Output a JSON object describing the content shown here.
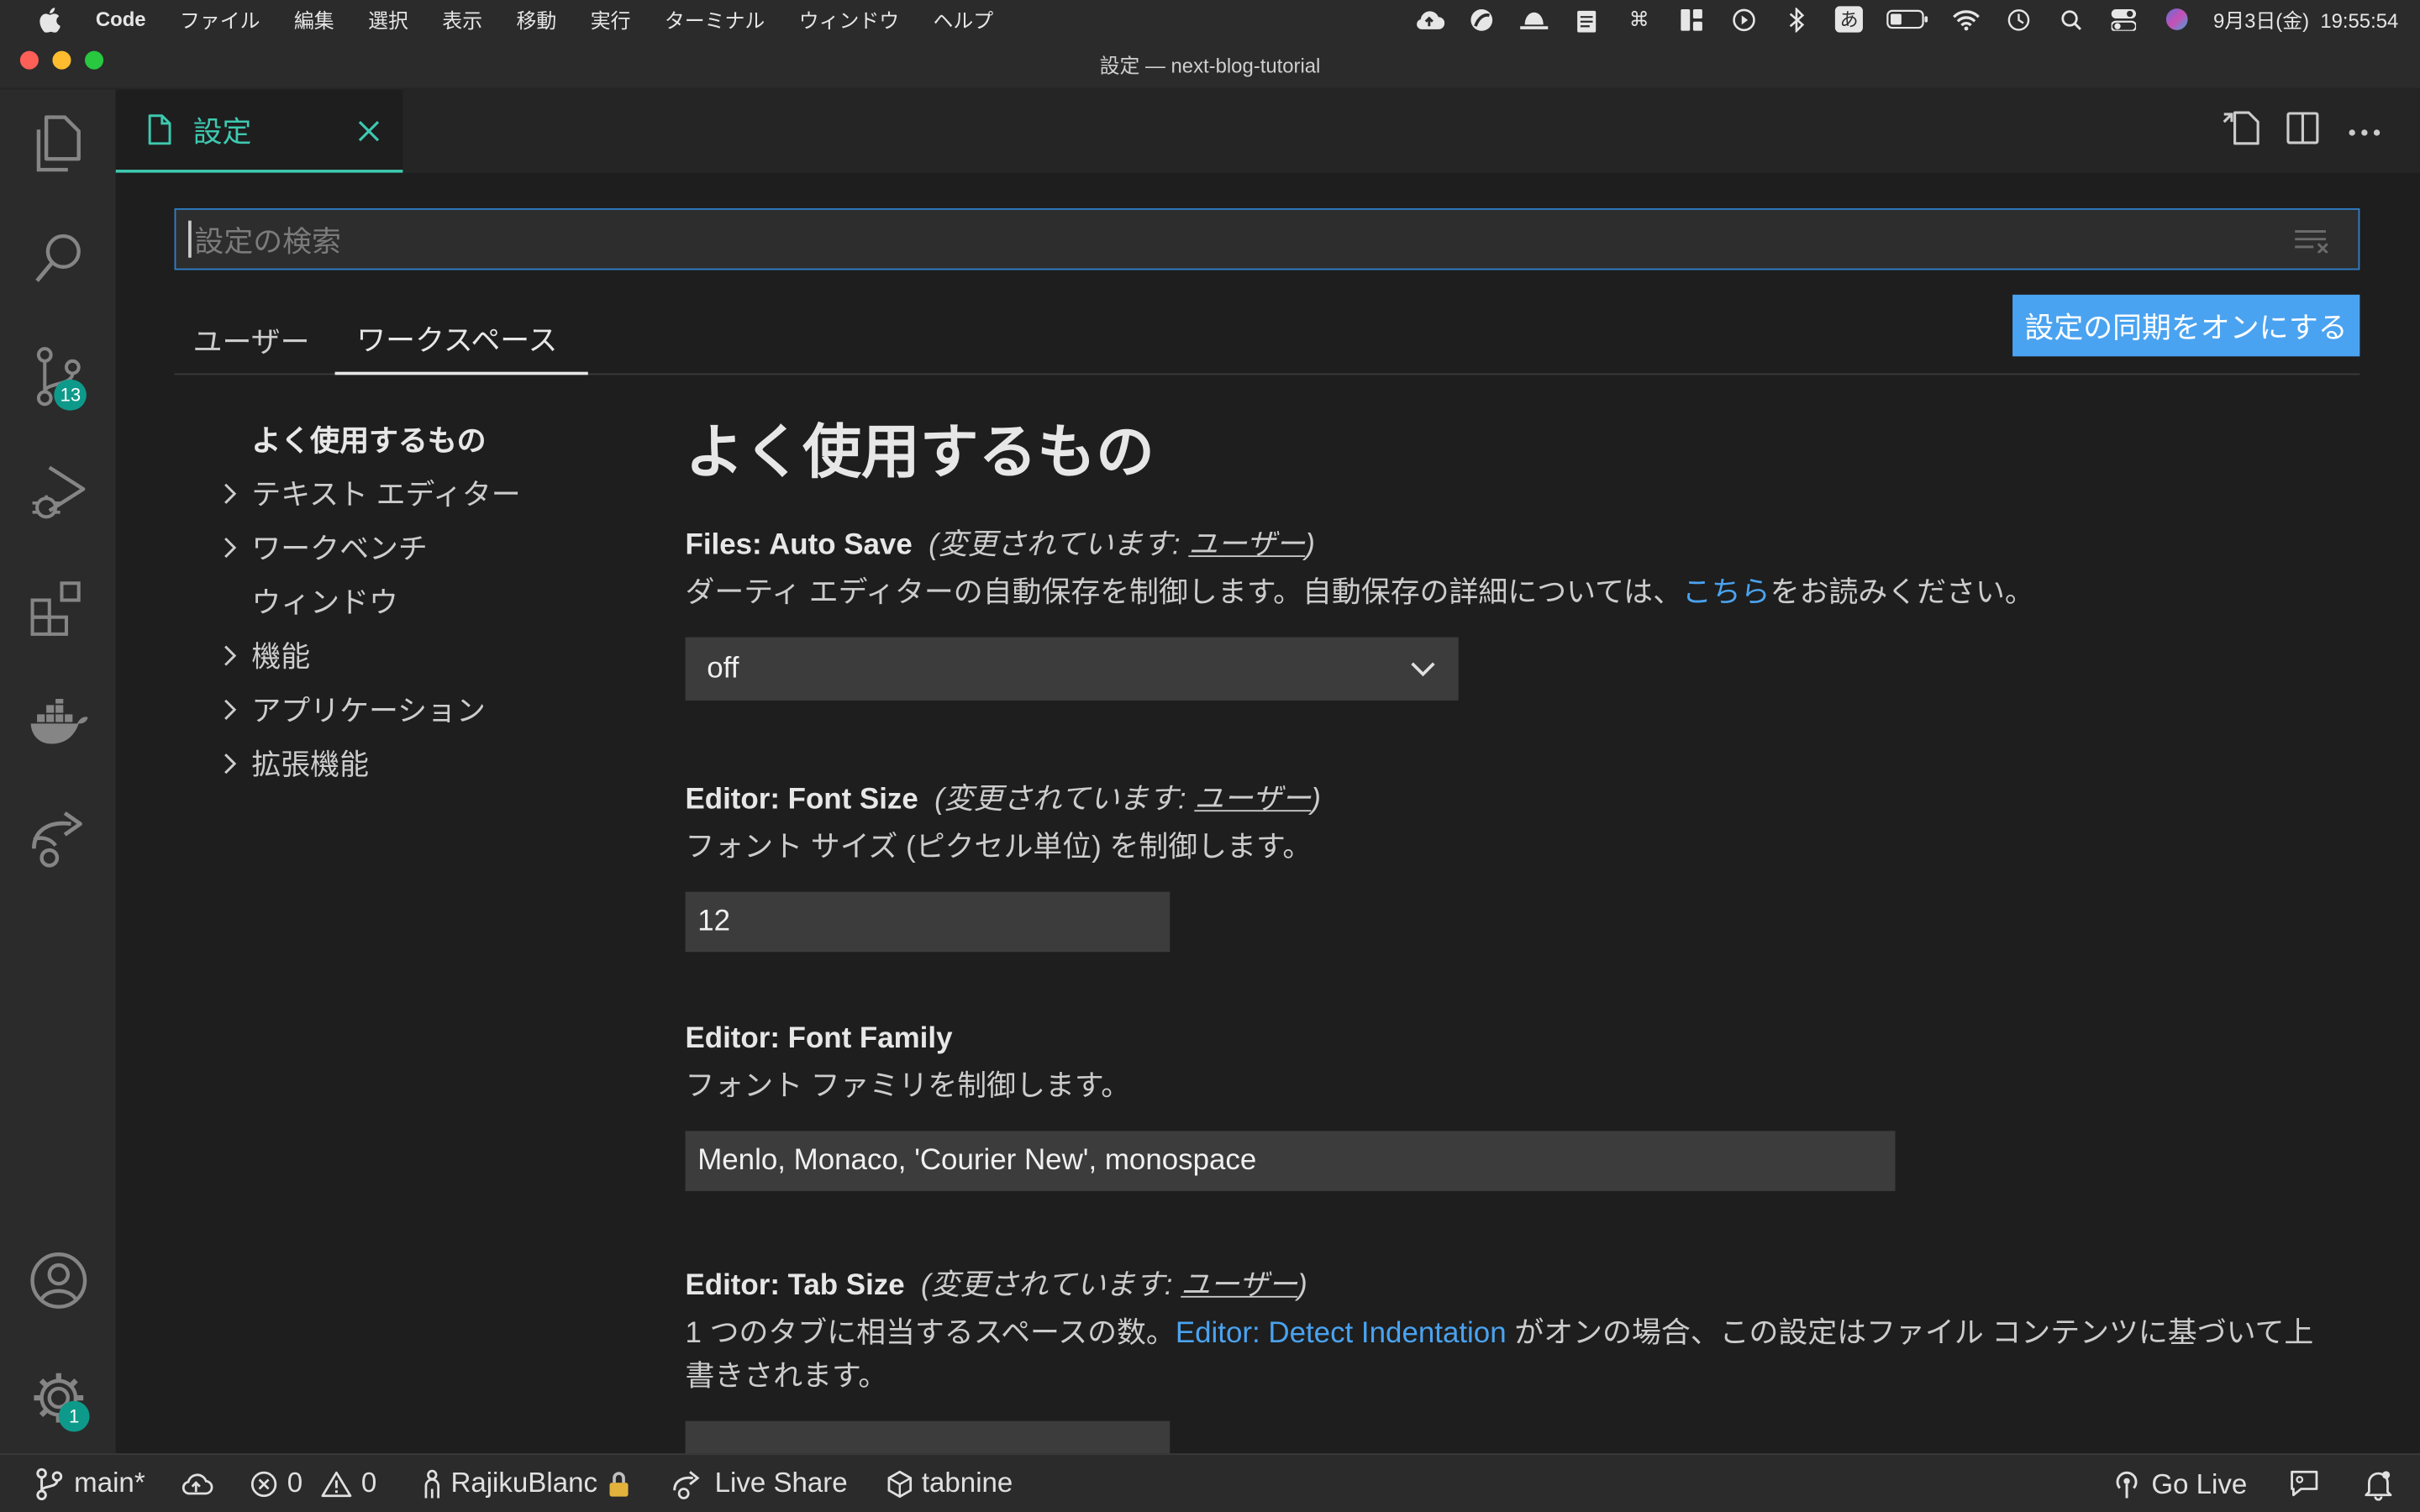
{
  "menubar": {
    "app": "Code",
    "items": [
      "ファイル",
      "編集",
      "選択",
      "表示",
      "移動",
      "実行",
      "ターミナル",
      "ウィンドウ",
      "ヘルプ"
    ],
    "status_icons": [
      "cloud-upload-icon",
      "swirl-icon",
      "hat-icon",
      "clipboard-icon",
      "command-icon",
      "layout-icon",
      "play-circle-icon",
      "bluetooth-icon",
      "ime-icon",
      "battery-icon",
      "wifi-icon",
      "time-machine-icon",
      "search-icon",
      "control-center-icon",
      "siri-icon"
    ],
    "ime_label": "あ",
    "datetime": "9月3日(金)  19:55:54"
  },
  "window": {
    "title": "設定 — next-blog-tutorial"
  },
  "activity": {
    "scm_badge": "13",
    "manage_badge": "1"
  },
  "tab": {
    "label": "設定"
  },
  "search": {
    "placeholder": "設定の検索"
  },
  "scopes": {
    "user": "ユーザー",
    "workspace": "ワークスペース",
    "sync": "設定の同期をオンにする"
  },
  "toc": [
    {
      "label": "よく使用するもの",
      "expandable": false,
      "bold": true
    },
    {
      "label": "テキスト エディター",
      "expandable": true
    },
    {
      "label": "ワークベンチ",
      "expandable": true
    },
    {
      "label": "ウィンドウ",
      "expandable": false
    },
    {
      "label": "機能",
      "expandable": true
    },
    {
      "label": "アプリケーション",
      "expandable": true
    },
    {
      "label": "拡張機能",
      "expandable": true
    }
  ],
  "content": {
    "heading": "よく使用するもの",
    "modified_prefix": "(変更されています: ",
    "modified_link": "ユーザー",
    "modified_suffix": ")",
    "auto_save": {
      "category": "Files: ",
      "name": "Auto Save",
      "desc_before": "ダーティ エディターの自動保存を制御します。自動保存の詳細については、",
      "desc_link": "こちら",
      "desc_after": "をお読みください。",
      "value": "off"
    },
    "font_size": {
      "category": "Editor: ",
      "name": "Font Size",
      "desc": "フォント サイズ (ピクセル単位) を制御します。",
      "value": "12"
    },
    "font_family": {
      "category": "Editor: ",
      "name": "Font Family",
      "desc": "フォント ファミリを制御します。",
      "value": "Menlo, Monaco, 'Courier New', monospace"
    },
    "tab_size": {
      "category": "Editor: ",
      "name": "Tab Size",
      "desc_before": "1 つのタブに相当するスペースの数。",
      "desc_link": "Editor: Detect Indentation",
      "desc_after": " がオンの場合、この設定はファイル コンテンツに基づいて上書きされます。"
    }
  },
  "statusbar": {
    "branch": "main*",
    "errors": "0",
    "warnings": "0",
    "user": "RajikuBlanc",
    "live_share": "Live Share",
    "tabnine": "tabnine",
    "go_live": "Go Live"
  },
  "colors": {
    "accent": "#3dc9b0",
    "link": "#4aa3f0",
    "badge": "#0e9a8a"
  }
}
